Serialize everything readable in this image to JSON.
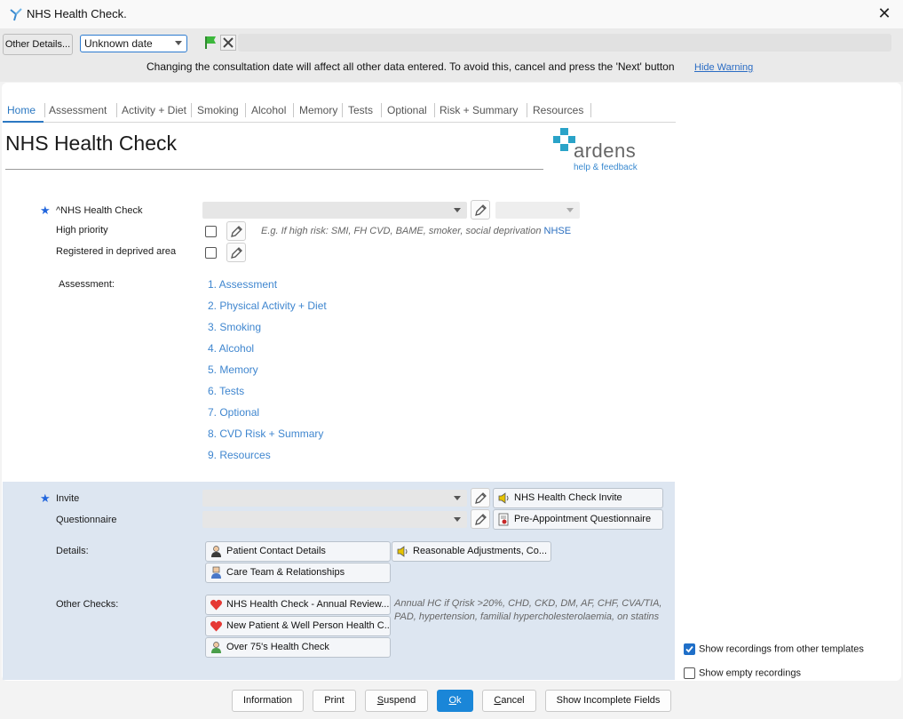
{
  "window": {
    "title": "NHS Health Check.",
    "close_icon": "close-icon"
  },
  "toolbar": {
    "other_details_label": "Other Details...",
    "date_value": "Unknown date",
    "warning_text": "Changing the consultation date will affect all other data entered. To avoid this, cancel and press the 'Next' button",
    "hide_warning_label": "Hide Warning"
  },
  "tabs": [
    {
      "label": "Home",
      "active": true
    },
    {
      "label": "Assessment"
    },
    {
      "label": "Activity + Diet"
    },
    {
      "label": "Smoking"
    },
    {
      "label": "Alcohol"
    },
    {
      "label": "Memory"
    },
    {
      "label": "Tests"
    },
    {
      "label": "Optional"
    },
    {
      "label": "Risk + Summary"
    },
    {
      "label": "Resources"
    }
  ],
  "page": {
    "title": "NHS Health Check",
    "logo_text": "ardens",
    "logo_sub": "help & feedback"
  },
  "fields": {
    "nhs_health_check": {
      "label": "^NHS Health Check"
    },
    "high_priority": {
      "label": "High priority",
      "hint": "E.g.  If high risk: SMI, FH CVD, BAME, smoker, social deprivation",
      "hint_link": "NHSE"
    },
    "deprived_area": {
      "label": "Registered in deprived area"
    }
  },
  "assessment": {
    "label": "Assessment:",
    "links": [
      "1. Assessment",
      "2. Physical Activity + Diet",
      "3. Smoking",
      "4. Alcohol",
      "5. Memory",
      "6. Tests",
      "7. Optional",
      "8. CVD Risk + Summary",
      "9. Resources"
    ]
  },
  "lower": {
    "invite_label": "Invite",
    "invite_button": "NHS Health Check Invite",
    "questionnaire_label": "Questionnaire",
    "questionnaire_button": "Pre-Appointment Questionnaire",
    "details_label": "Details:",
    "patient_contact": "Patient Contact Details",
    "reasonable_adjustments": "Reasonable Adjustments, Co...",
    "care_team": "Care Team & Relationships",
    "other_checks_label": "Other Checks:",
    "annual_review": "NHS Health Check - Annual Review...",
    "new_patient": "New Patient & Well Person Health C...",
    "over_75": "Over 75's Health Check",
    "annual_note_line1": "Annual HC if Qrisk >20%, CHD, CKD, DM, AF, CHF, CVA/TIA,",
    "annual_note_line2": "PAD, hypertension, familial hypercholesterolaemia, on statins"
  },
  "options": {
    "show_other_templates": {
      "label": "Show recordings from other templates",
      "checked": true
    },
    "show_empty": {
      "label": "Show empty recordings",
      "checked": false
    }
  },
  "footer": {
    "information": "Information",
    "print": "Print",
    "suspend_u": "S",
    "suspend_rest": "uspend",
    "ok_u": "O",
    "ok_rest": "k",
    "cancel_u": "C",
    "cancel_rest": "ancel",
    "show_incomplete": "Show Incomplete Fields"
  },
  "colors": {
    "accent": "#2b78c2",
    "primary_button": "#1a86d8",
    "lower_panel": "#dde6f1"
  }
}
